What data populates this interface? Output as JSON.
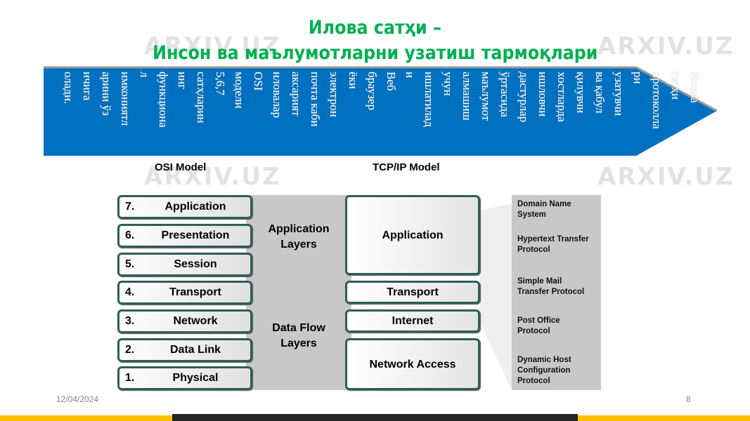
{
  "title": {
    "line1": "Илова сатҳи –",
    "line2": "Инсон ва маълумотларни узатиш тармоқлари"
  },
  "arrow_text_lines": [
    "Илова",
    "сатҳи",
    "протоколла",
    "ри",
    "узатувчи",
    "ва қабул",
    "қилувчи",
    "хостларда",
    "ишловчи",
    "дастурлар",
    "ўртасида",
    "маълумот",
    "алмашиш",
    "учун",
    "ишлатилад",
    "и",
    "Веб",
    "браузер",
    "ёки",
    "электрон",
    "почта каби",
    "аксарият",
    "иловалар",
    "OSI",
    "модели",
    "5,6,7",
    "сатҳларин",
    "инг",
    "функциона",
    "л",
    "имкониятл",
    "арини ўз",
    "ичига",
    "олади."
  ],
  "diagram": {
    "osi_header": "OSI Model",
    "tcp_header": "TCP/IP Model",
    "osi_layers": [
      {
        "num": "7.",
        "label": "Application"
      },
      {
        "num": "6.",
        "label": "Presentation"
      },
      {
        "num": "5.",
        "label": "Session"
      },
      {
        "num": "4.",
        "label": "Transport"
      },
      {
        "num": "3.",
        "label": "Network"
      },
      {
        "num": "2.",
        "label": "Data Link"
      },
      {
        "num": "1.",
        "label": "Physical"
      }
    ],
    "groups": [
      "Application Layers",
      "Data Flow Layers"
    ],
    "tcp_layers": [
      "Application",
      "Transport",
      "Internet",
      "Network Access"
    ],
    "protocols": [
      "Domain Name System",
      "Hypertext Transfer Protocol",
      "Simple Mail Transfer Protocol",
      "Post Office Protocol",
      "Dynamic Host Configuration Protocol"
    ]
  },
  "footer": {
    "date": "12/04/2024",
    "page": "8"
  },
  "watermark": "ARXIV.UZ",
  "colors": {
    "title": "#00b050",
    "arrow": "#0070c0",
    "layer_border": "#2e5e52",
    "bottom_bar": "#ffc000"
  }
}
